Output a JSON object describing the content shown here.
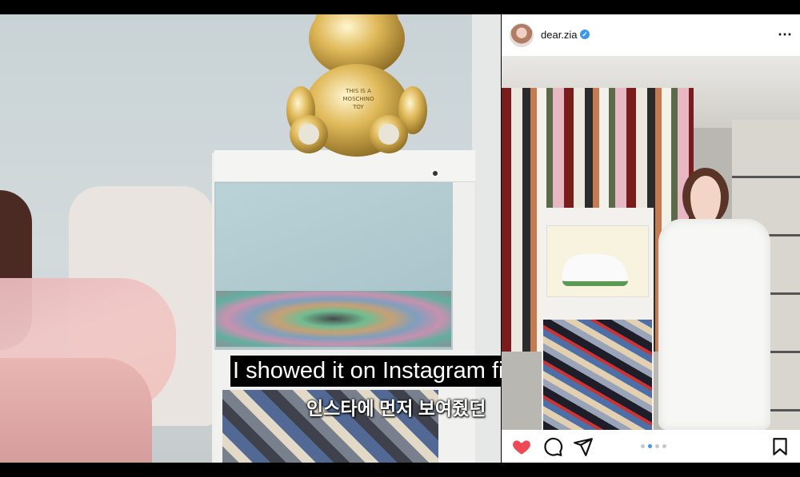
{
  "captions": {
    "english": "I showed it on Instagram first",
    "korean": "인스타에 먼저 보여줬던"
  },
  "instagram_post": {
    "username": "dear.zia",
    "verified_icon": "verified-badge-icon",
    "more_icon": "more-options-icon",
    "actions": {
      "like_icon": "heart-filled-icon",
      "comment_icon": "comment-icon",
      "share_icon": "send-icon",
      "save_icon": "bookmark-icon"
    },
    "carousel": {
      "total": 4,
      "active_index": 1
    },
    "colors": {
      "like": "#ed4956",
      "verified": "#3897f0",
      "active_dot": "#3897f0"
    }
  },
  "bear_lettering": [
    "THIS IS A",
    "MOSCHINO",
    "TOY"
  ]
}
